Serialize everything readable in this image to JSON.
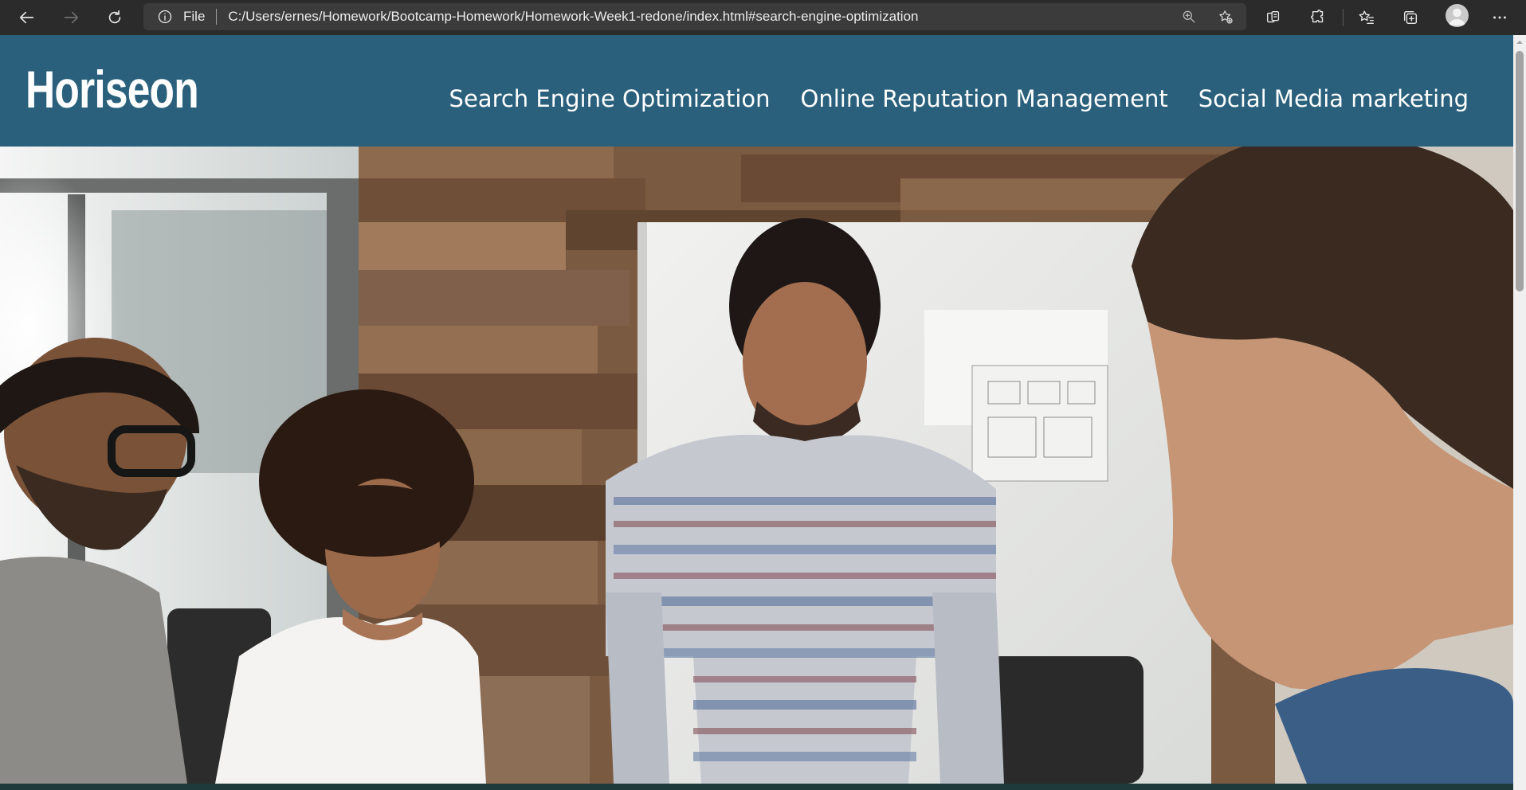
{
  "browser": {
    "scheme_label": "File",
    "url": "C:/Users/ernes/Homework/Bootcamp-Homework/Homework-Week1-redone/index.html#search-engine-optimization",
    "icons": {
      "back": "back-arrow-icon",
      "forward": "forward-arrow-icon",
      "refresh": "refresh-icon",
      "info": "info-icon",
      "zoom": "zoom-icon",
      "add_favorite": "add-favorite-icon",
      "copilot": "copilot-icon",
      "extensions": "puzzle-icon",
      "favorites": "favorites-icon",
      "collections": "collections-icon",
      "profile": "profile-icon",
      "more": "more-icon"
    }
  },
  "site": {
    "logo": "Horiseon",
    "nav": [
      {
        "label": "Search Engine Optimization"
      },
      {
        "label": "Online Reputation Management"
      },
      {
        "label": "Social Media marketing"
      }
    ],
    "colors": {
      "header": "#2a607c",
      "nav_text": "#ffffff"
    }
  }
}
